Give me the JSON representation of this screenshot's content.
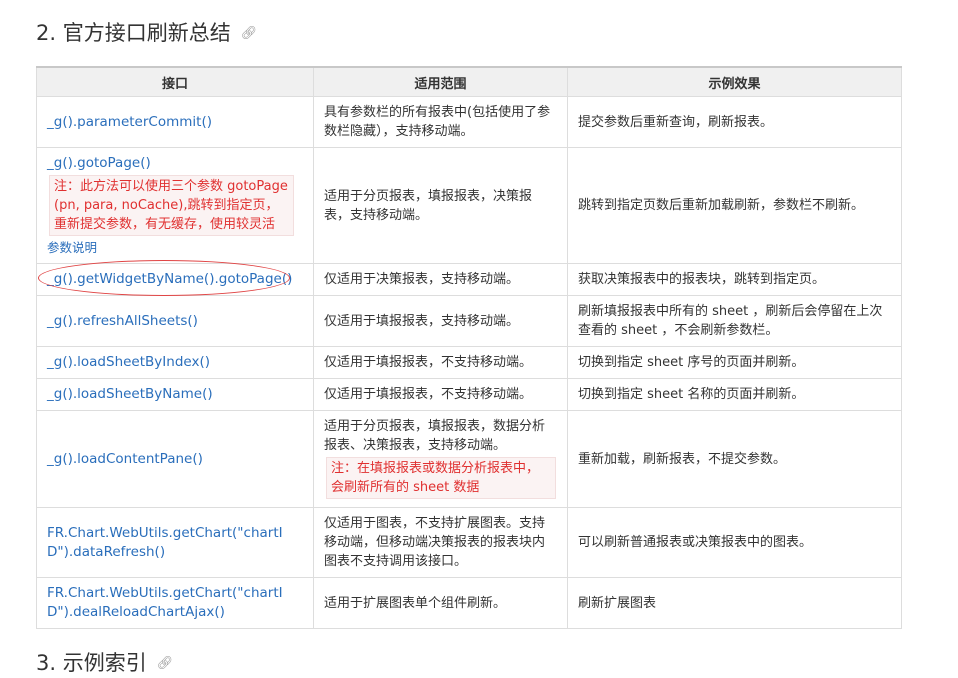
{
  "section2": {
    "title": "2. 官方接口刷新总结",
    "link_icon": "link-icon"
  },
  "section3": {
    "title": "3. 示例索引",
    "link_icon": "link-icon"
  },
  "table": {
    "headers": [
      "接口",
      "适用范围",
      "示例效果"
    ],
    "rows": [
      {
        "api": "_g().parameterCommit()",
        "scope": "具有参数栏的所有报表中(包括使用了参数栏隐藏），支持移动端。",
        "effect": "提交参数后重新查询，刷新报表。"
      },
      {
        "api": "_g().gotoPage()",
        "api_note": "注：此方法可以使用三个参数 gotoPage(pn, para, noCache),跳转到指定页，重新提交参数，有无缓存，使用较灵活",
        "api_sublink": "参数说明",
        "scope": "适用于分页报表，填报报表，决策报表，支持移动端。",
        "effect": "跳转到指定页数后重新加载刷新，参数栏不刷新。"
      },
      {
        "api": "_g().getWidgetByName().gotoPage()",
        "scope": "仅适用于决策报表，支持移动端。",
        "effect": "获取决策报表中的报表块，跳转到指定页。"
      },
      {
        "api": "_g().refreshAllSheets()",
        "scope": "仅适用于填报报表，支持移动端。",
        "effect": "刷新填报报表中所有的 sheet ，刷新后会停留在上次查看的 sheet ，不会刷新参数栏。"
      },
      {
        "api": "_g().loadSheetByIndex()",
        "scope": "仅适用于填报报表，不支持移动端。",
        "effect": "切换到指定 sheet 序号的页面并刷新。"
      },
      {
        "api": "_g().loadSheetByName()",
        "scope": "仅适用于填报报表，不支持移动端。",
        "effect": "切换到指定 sheet 名称的页面并刷新。"
      },
      {
        "api": "_g().loadContentPane()",
        "scope": "适用于分页报表，填报报表，数据分析报表、决策报表，支持移动端。",
        "scope_note": "注：在填报报表或数据分析报表中，会刷新所有的 sheet 数据",
        "effect": "重新加载，刷新报表，不提交参数。"
      },
      {
        "api": "FR.Chart.WebUtils.getChart(\"chartID\").dataRefresh()",
        "scope": "仅适用于图表，不支持扩展图表。支持移动端，但移动端决策报表的报表块内图表不支持调用该接口。",
        "effect": "可以刷新普通报表或决策报表中的图表。"
      },
      {
        "api": "FR.Chart.WebUtils.getChart(\"chartID\").dealReloadChartAjax()",
        "scope": "适用于扩展图表单个组件刷新。",
        "effect": "刷新扩展图表"
      }
    ]
  }
}
